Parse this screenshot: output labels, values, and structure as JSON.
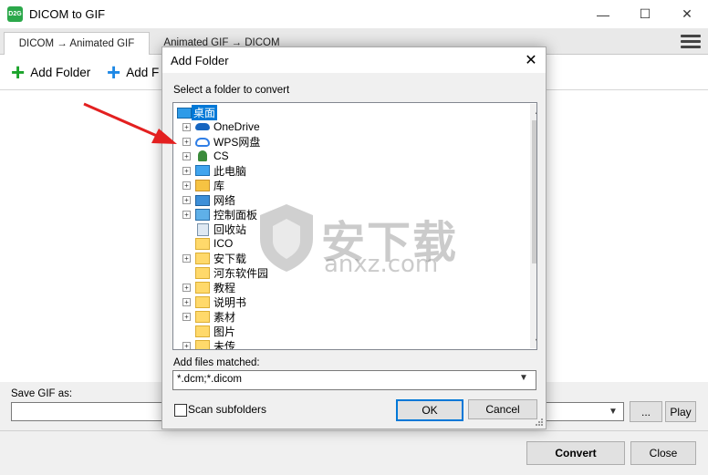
{
  "window": {
    "title": "DICOM to GIF",
    "app_icon_text": "D2G",
    "controls": [
      "—",
      "☐",
      "✕"
    ]
  },
  "tabs": [
    {
      "label": "DICOM → Animated GIF",
      "active": true
    },
    {
      "label": "Animated GIF → DICOM",
      "active": false
    }
  ],
  "toolbar": {
    "add_folder_label": "Add Folder",
    "add_file_label": "Add F",
    "plus_glyph": "+",
    "colors": {
      "add_folder": "#1aa32a",
      "add_file": "#1e88e5"
    }
  },
  "save": {
    "label": "Save GIF as:",
    "value": "",
    "browse_label": "...",
    "play_label": "Play"
  },
  "footer": {
    "convert_label": "Convert",
    "close_label": "Close"
  },
  "dialog": {
    "title": "Add Folder",
    "close_glyph": "✕",
    "prompt": "Select a folder to convert",
    "tree": [
      {
        "label": "桌面",
        "icon": "desktop-icon",
        "expander": false,
        "selected": true
      },
      {
        "label": "OneDrive",
        "icon": "onedrive-cloud-icon",
        "expander": true
      },
      {
        "label": "WPS网盘",
        "icon": "wps-cloud-icon",
        "expander": true
      },
      {
        "label": "CS",
        "icon": "user-icon",
        "expander": true
      },
      {
        "label": "此电脑",
        "icon": "computer-icon",
        "expander": true
      },
      {
        "label": "库",
        "icon": "library-icon",
        "expander": true
      },
      {
        "label": "网络",
        "icon": "network-icon",
        "expander": true
      },
      {
        "label": "控制面板",
        "icon": "control-panel-icon",
        "expander": true
      },
      {
        "label": "回收站",
        "icon": "recycle-bin-icon",
        "expander": false
      },
      {
        "label": "ICO",
        "icon": "folder-icon",
        "expander": false
      },
      {
        "label": "安下载",
        "icon": "folder-icon",
        "expander": true
      },
      {
        "label": "河东软件园",
        "icon": "folder-icon",
        "expander": false
      },
      {
        "label": "教程",
        "icon": "folder-icon",
        "expander": true
      },
      {
        "label": "说明书",
        "icon": "folder-icon",
        "expander": true
      },
      {
        "label": "素材",
        "icon": "folder-icon",
        "expander": true
      },
      {
        "label": "图片",
        "icon": "folder-icon",
        "expander": false
      },
      {
        "label": "未传",
        "icon": "folder-icon",
        "expander": true
      }
    ],
    "match_label": "Add files matched:",
    "match_value": "*.dcm;*.dicom",
    "scan_subfolders_label": "Scan subfolders",
    "scan_subfolders_checked": false,
    "ok_label": "OK",
    "cancel_label": "Cancel",
    "colors": {
      "selection": "#0078d7"
    }
  },
  "watermark": {
    "cn": "安下载",
    "en": "anxz.com"
  },
  "annotation": {
    "arrow_color": "#e32020"
  }
}
